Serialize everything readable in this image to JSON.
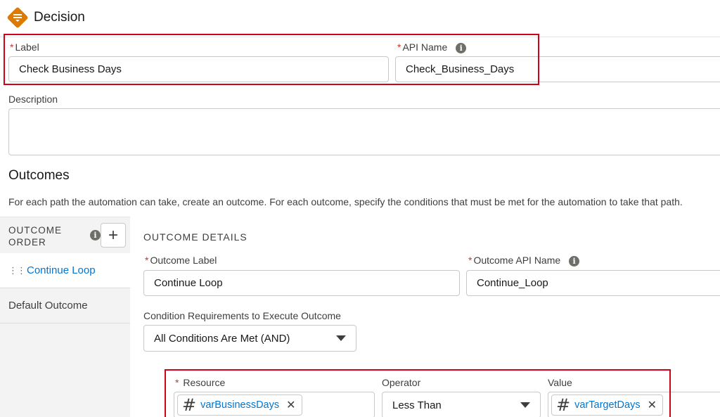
{
  "header": {
    "title": "Decision",
    "icon": "decision-icon"
  },
  "fields": {
    "label": {
      "label": "Label",
      "value": "Check Business Days"
    },
    "api_name": {
      "label": "API Name",
      "value": "Check_Business_Days"
    },
    "description": {
      "label": "Description",
      "value": ""
    }
  },
  "outcomes": {
    "title": "Outcomes",
    "description": "For each path the automation can take, create an outcome. For each outcome, specify the conditions that must be met for the automation to take that path.",
    "order_label_line1": "OUTCOME",
    "order_label_line2": "ORDER",
    "add_label": "+",
    "items": [
      {
        "label": "Continue Loop"
      },
      {
        "label": "Default Outcome"
      }
    ]
  },
  "details": {
    "title": "OUTCOME DETAILS",
    "outcome_label": {
      "label": "Outcome Label",
      "value": "Continue Loop"
    },
    "outcome_api_name": {
      "label": "Outcome API Name",
      "value": "Continue_Loop"
    },
    "condition_req": {
      "label": "Condition Requirements to Execute Outcome",
      "value": "All Conditions Are Met (AND)"
    },
    "condition": {
      "resource_label": "Resource",
      "resource_value": "varBusinessDays",
      "operator_label": "Operator",
      "operator_value": "Less Than",
      "value_label": "Value",
      "value_value": "varTargetDays"
    }
  },
  "colors": {
    "accent": "#0176d3",
    "highlight": "#d0021b",
    "icon_orange": "#dd7a01"
  }
}
